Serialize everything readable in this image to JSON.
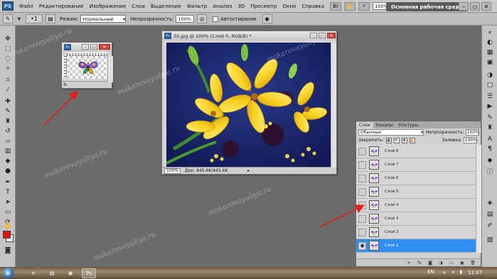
{
  "menubar": {
    "logo": "PS",
    "items": [
      "Файл",
      "Редактирование",
      "Изображение",
      "Слои",
      "Выделение",
      "Фильтр",
      "Анализ",
      "3D",
      "Просмотр",
      "Окно",
      "Справка"
    ],
    "zoom_value": "100%",
    "workspace_button": "Основная рабочая среда"
  },
  "options": {
    "mode_label": "Режим:",
    "mode_value": "Нормальный",
    "opacity_label": "Непрозрачность:",
    "opacity_value": "100%",
    "autoerase_label": "Автостирание"
  },
  "small_doc": {
    "zoom": "66.7%",
    "corner_label": "b"
  },
  "main_doc": {
    "title": "35.jpg @ 100% (Слой 0, RGB/8) *",
    "status_zoom": "100%",
    "status_doc": "Док: 445,6K/445,6K"
  },
  "layers_panel": {
    "tabs": [
      "Слои",
      "Каналы",
      "Контуры"
    ],
    "blend_mode": "Обычные",
    "opacity_label": "Непрозрачность:",
    "opacity_value": "100%",
    "lock_label": "Закрепить:",
    "fill_label": "Заливка:",
    "fill_value": "100%",
    "layers": [
      {
        "name": "Слой 8",
        "visible": false,
        "selected": false
      },
      {
        "name": "Слой 7",
        "visible": false,
        "selected": false
      },
      {
        "name": "Слой 6",
        "visible": false,
        "selected": false
      },
      {
        "name": "Слой 5",
        "visible": false,
        "selected": false
      },
      {
        "name": "Слой 4",
        "visible": false,
        "selected": false
      },
      {
        "name": "Слой 3",
        "visible": false,
        "selected": false
      },
      {
        "name": "Слой 2",
        "visible": false,
        "selected": false
      },
      {
        "name": "Слой 1",
        "visible": true,
        "selected": true
      }
    ]
  },
  "taskbar": {
    "lang": "EN",
    "clock": "11:37"
  },
  "watermark": "makarovayuliya.ru",
  "colors": {
    "foreground": "#e01010",
    "background": "#ffffff",
    "selection": "#2f8ef0",
    "arrow": "#e0201a"
  }
}
